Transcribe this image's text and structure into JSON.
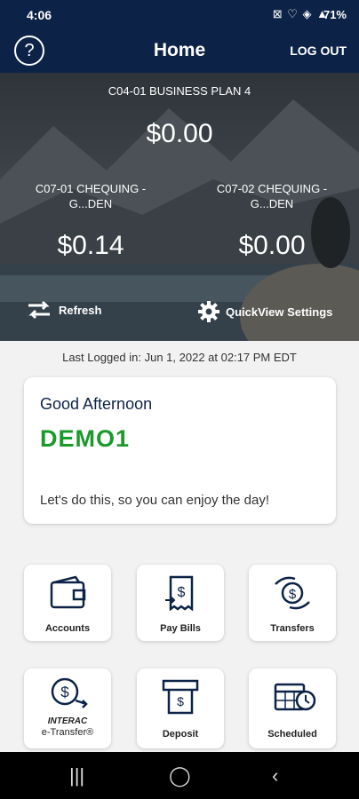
{
  "status": {
    "time": "4:06",
    "icons": "⊠ ♡ ◈ ▲",
    "battery": "71%"
  },
  "nav": {
    "help": "?",
    "title": "Home",
    "logout": "LOG OUT"
  },
  "accounts": [
    {
      "name": "C04-01 BUSINESS PLAN 4",
      "amount": "$0.00"
    },
    {
      "name": "C07-01 CHEQUING -\nG...DEN",
      "amount": "$0.14"
    },
    {
      "name": "C07-02 CHEQUING -\nG...DEN",
      "amount": "$0.00"
    }
  ],
  "actions": {
    "refresh": "Refresh",
    "settings": "QuickView Settings"
  },
  "last_login": "Last Logged in: Jun 1, 2022 at 02:17 PM  EDT",
  "greeting": {
    "salutation": "Good Afternoon",
    "user": "DEMO1",
    "message": "Let's do this, so you can enjoy the day!"
  },
  "tiles": [
    {
      "label": "Accounts",
      "icon": "wallet-icon"
    },
    {
      "label": "Pay Bills",
      "icon": "bill-icon"
    },
    {
      "label": "Transfers",
      "icon": "transfer-icon"
    },
    {
      "label_1": "INTERAC",
      "label_2": "e-Transfer®",
      "icon": "etransfer-icon"
    },
    {
      "label": "Deposit",
      "icon": "deposit-icon"
    },
    {
      "label": "Scheduled",
      "icon": "calendar-icon"
    }
  ],
  "colors": {
    "navy": "#0c2347",
    "green": "#1a9a2a"
  }
}
